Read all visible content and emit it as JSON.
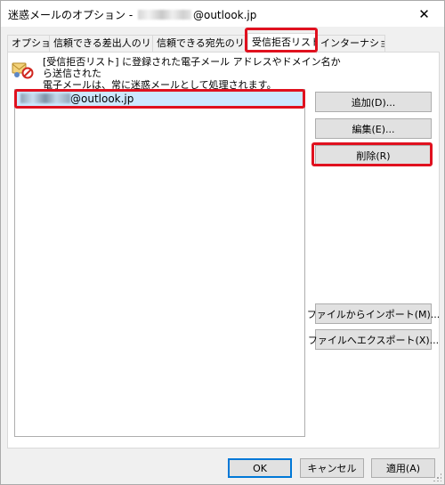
{
  "window": {
    "title_prefix": "迷惑メールのオプション -",
    "title_suffix": "@outlook.jp",
    "close_symbol": "✕"
  },
  "tabs": [
    {
      "label": "オプション"
    },
    {
      "label": "信頼できる差出人のリスト"
    },
    {
      "label": "信頼できる宛先のリスト"
    },
    {
      "label": "受信拒否リスト",
      "selected": true
    },
    {
      "label": "インターナショナル"
    }
  ],
  "panel": {
    "description_line1": "[受信拒否リスト] に登録された電子メール アドレスやドメイン名から送信された",
    "description_line2": "電子メールは、常に迷惑メールとして処理されます。",
    "info_icon": "blocked-senders-icon",
    "list": [
      {
        "suffix": "@outlook.jp",
        "selected": true
      }
    ]
  },
  "buttons": {
    "add": "追加(D)...",
    "edit": "編集(E)...",
    "delete": "削除(R)",
    "import": "ファイルからインポート(M)...",
    "export": "ファイルへエクスポート(X)..."
  },
  "footer": {
    "ok": "OK",
    "cancel": "キャンセル",
    "apply": "適用(A)"
  },
  "colors": {
    "highlight_red": "#e0111f",
    "selection_blue": "#cce8ff",
    "default_button_border": "#0078d7"
  }
}
